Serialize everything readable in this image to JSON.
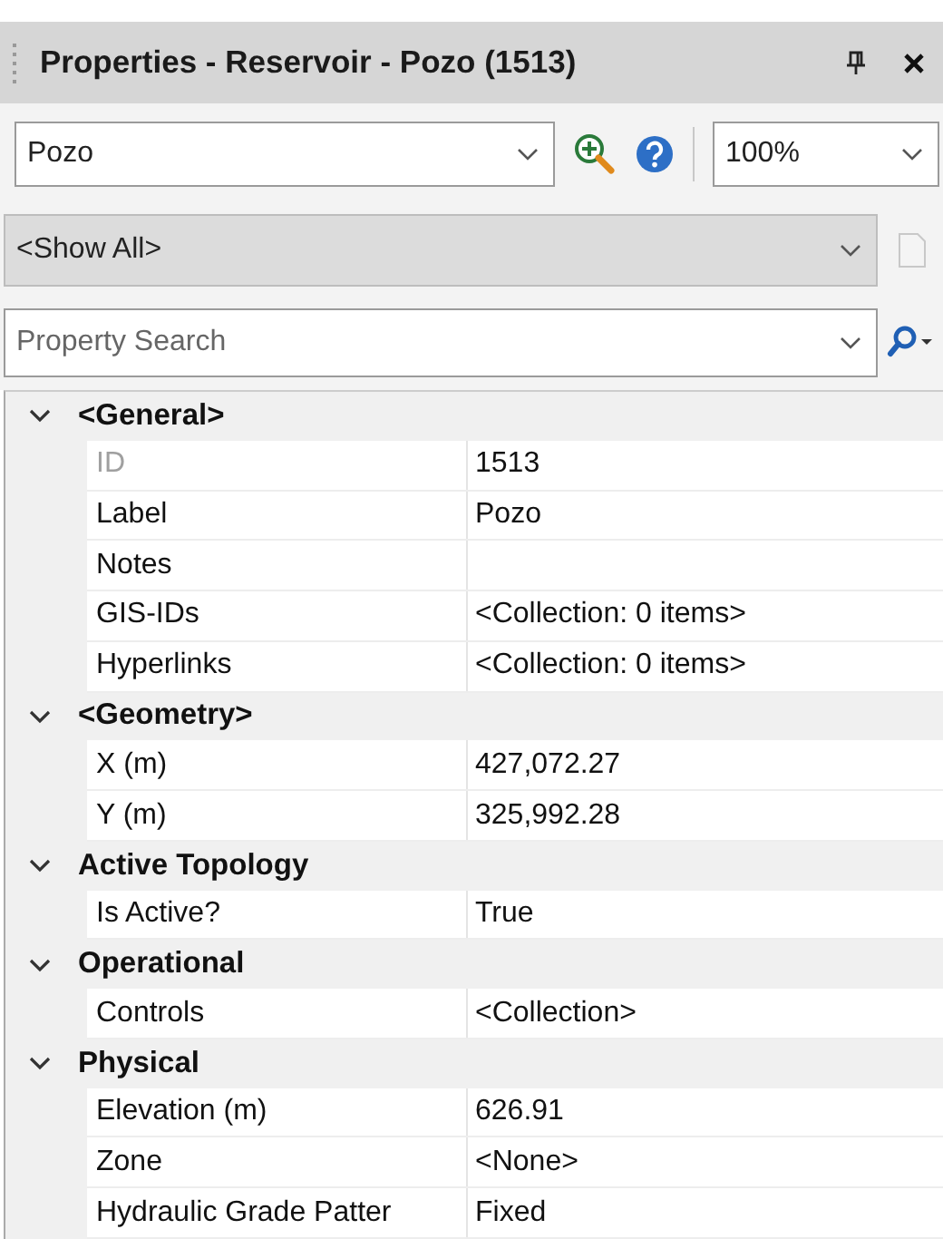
{
  "window": {
    "title": "Properties - Reservoir - Pozo (1513)"
  },
  "toolbar": {
    "element": {
      "value": "Pozo"
    },
    "zoom": {
      "value": "100%"
    }
  },
  "filter": {
    "value": "<Show All>"
  },
  "search": {
    "placeholder": "Property Search"
  },
  "categories": [
    {
      "name": "<General>",
      "expanded": true,
      "properties": [
        {
          "name": "ID",
          "value": "1513",
          "readonly": true
        },
        {
          "name": "Label",
          "value": "Pozo",
          "readonly": false
        },
        {
          "name": "Notes",
          "readonly": false
        },
        {
          "name": "GIS-IDs",
          "value": "<Collection: 0 items>",
          "readonly": false
        },
        {
          "name": "Hyperlinks",
          "value": "<Collection: 0 items>",
          "readonly": false
        }
      ]
    },
    {
      "name": "<Geometry>",
      "expanded": true,
      "properties": [
        {
          "name": "X (m)",
          "value": "427,072.27",
          "readonly": false
        },
        {
          "name": "Y (m)",
          "value": "325,992.28",
          "readonly": false
        }
      ]
    },
    {
      "name": "Active Topology",
      "expanded": true,
      "properties": [
        {
          "name": "Is Active?",
          "value": "True",
          "readonly": false
        }
      ]
    },
    {
      "name": "Operational",
      "expanded": true,
      "properties": [
        {
          "name": "Controls",
          "value": "<Collection>",
          "readonly": false
        }
      ]
    },
    {
      "name": "Physical",
      "expanded": true,
      "properties": [
        {
          "name": "Elevation (m)",
          "value": "626.91",
          "readonly": false
        },
        {
          "name": "Zone",
          "value": "<None>",
          "readonly": false
        },
        {
          "name": "Hydraulic Grade Patter",
          "value": "Fixed",
          "readonly": false
        }
      ]
    }
  ]
}
